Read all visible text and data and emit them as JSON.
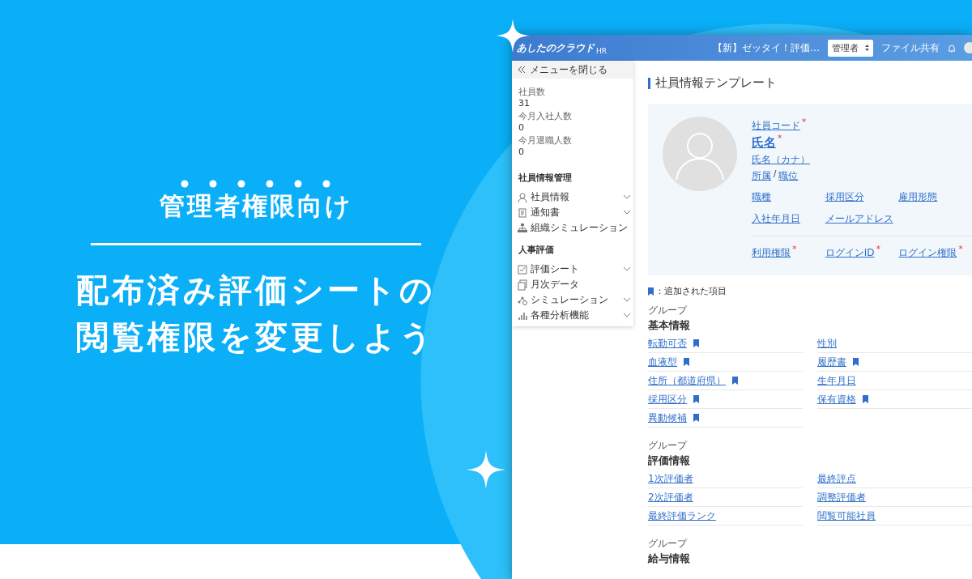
{
  "banner": {
    "kicker": "管理者権限向け",
    "title_lines": [
      "配布済み評価シートの",
      "閲覧権限を変更しよう"
    ]
  },
  "app": {
    "header": {
      "logo": "あしたのクラウド",
      "logo_suffix": "HR",
      "notice": "【新】ゼッタイ！評価…",
      "role_select": "管理者",
      "file_share": "ファイル共有"
    },
    "sidebar": {
      "close_menu": "メニューを閉じる",
      "stats": [
        {
          "label": "社員数",
          "value": "31"
        },
        {
          "label": "今月入社人数",
          "value": "0"
        },
        {
          "label": "今月退職人数",
          "value": "0"
        }
      ],
      "sections": [
        {
          "title": "社員情報管理",
          "items": [
            {
              "label": "社員情報",
              "expandable": true
            },
            {
              "label": "通知書",
              "expandable": true
            },
            {
              "label": "組織シミュレーション",
              "expandable": false
            }
          ]
        },
        {
          "title": "人事評価",
          "items": [
            {
              "label": "評価シート",
              "expandable": true
            },
            {
              "label": "月次データ",
              "expandable": false
            },
            {
              "label": "シミュレーション",
              "expandable": true
            },
            {
              "label": "各種分析機能",
              "expandable": true
            }
          ]
        }
      ]
    },
    "page_title": "社員情報テンプレート",
    "profile": {
      "code": {
        "label": "社員コード",
        "required_mark": "*"
      },
      "name": {
        "label": "氏名",
        "required_mark": "*"
      },
      "kana": "氏名（カナ）",
      "department": "所属",
      "separator": "/",
      "position": "職位",
      "fields": [
        {
          "label": "職種"
        },
        {
          "label": "採用区分"
        },
        {
          "label": "雇用形態"
        },
        {
          "label": "入社年月日"
        },
        {
          "label": "メールアドレス"
        }
      ],
      "account_fields": [
        {
          "label": "利用権限",
          "required_mark": "*"
        },
        {
          "label": "ログインID",
          "required_mark": "*"
        },
        {
          "label": "ログイン権限",
          "required_mark": "*"
        }
      ]
    },
    "legend": "：追加された項目",
    "groups": [
      {
        "caption": "グループ",
        "title": "基本情報",
        "fields": [
          {
            "label": "転勤可否",
            "added": true
          },
          {
            "label": "性別",
            "added": false
          },
          {
            "label": "血液型",
            "added": true
          },
          {
            "label": "履歴書",
            "added": true
          },
          {
            "label": "住所（都道府県）",
            "added": true
          },
          {
            "label": "生年月日",
            "added": false
          },
          {
            "label": "採用区分",
            "added": true
          },
          {
            "label": "保有資格",
            "added": true
          },
          {
            "label": "異動候補",
            "added": true
          }
        ]
      },
      {
        "caption": "グループ",
        "title": "評価情報",
        "fields": [
          {
            "label": "1次評価者",
            "added": false
          },
          {
            "label": "最終評点",
            "added": false
          },
          {
            "label": "2次評価者",
            "added": false
          },
          {
            "label": "調整評価者",
            "added": false
          },
          {
            "label": "最終評価ランク",
            "added": false
          },
          {
            "label": "閲覧可能社員",
            "added": false
          }
        ]
      },
      {
        "caption": "グループ",
        "title": "給与情報"
      }
    ]
  }
}
